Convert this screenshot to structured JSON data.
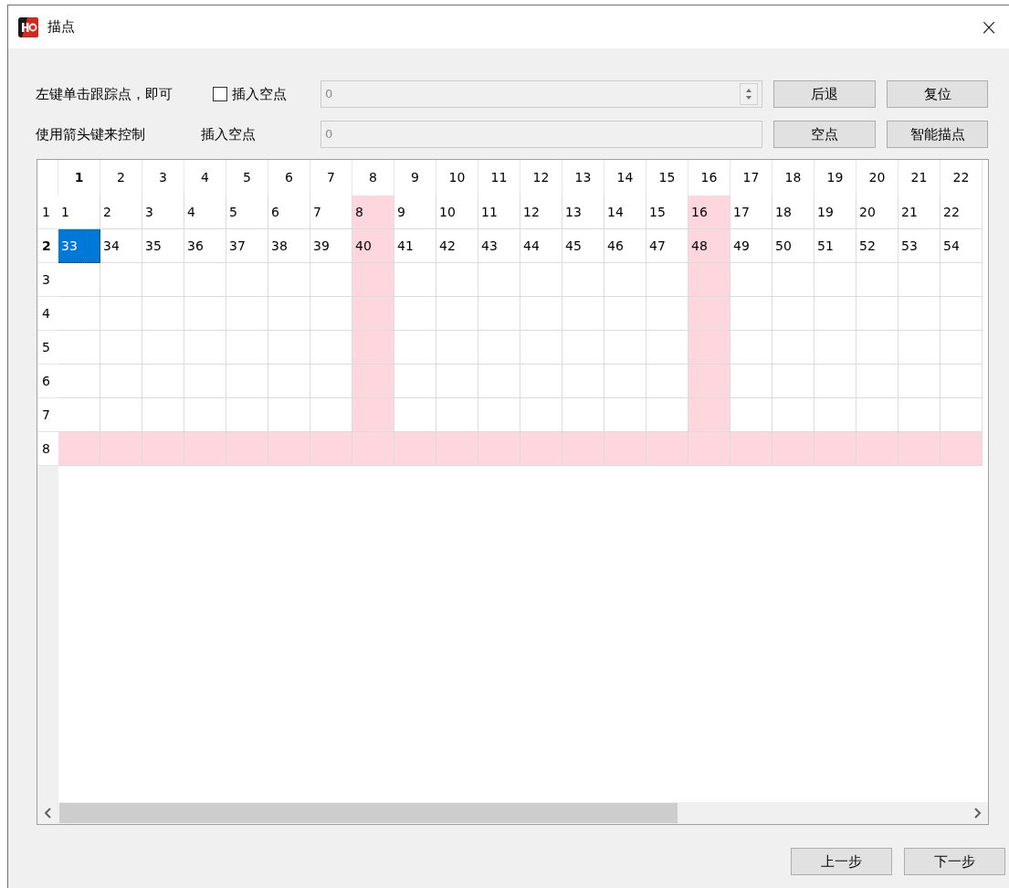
{
  "window": {
    "title": "描点",
    "close": "×"
  },
  "controls": {
    "hint_1": "左键单击跟踪点，即可",
    "hint_2": "使用箭头键来控制",
    "checkbox": {
      "label": "插入空点",
      "checked": false
    },
    "label_2": "插入空点",
    "field_1": {
      "value": "0",
      "disabled": true
    },
    "field_2": {
      "value": "0",
      "disabled": true
    },
    "buttons": [
      "后退",
      "复位",
      "空点",
      "智能描点"
    ]
  },
  "grid": {
    "columns": [
      {
        "label": "1",
        "selected": true,
        "marked": false
      },
      {
        "label": "2",
        "selected": false,
        "marked": false
      },
      {
        "label": "3",
        "selected": false,
        "marked": false
      },
      {
        "label": "4",
        "selected": false,
        "marked": false
      },
      {
        "label": "5",
        "selected": false,
        "marked": false
      },
      {
        "label": "6",
        "selected": false,
        "marked": false
      },
      {
        "label": "7",
        "selected": false,
        "marked": false
      },
      {
        "label": "8",
        "selected": false,
        "marked": true
      },
      {
        "label": "9",
        "selected": false,
        "marked": false
      },
      {
        "label": "10",
        "selected": false,
        "marked": false
      },
      {
        "label": "11",
        "selected": false,
        "marked": false
      },
      {
        "label": "12",
        "selected": false,
        "marked": false
      },
      {
        "label": "13",
        "selected": false,
        "marked": false
      },
      {
        "label": "14",
        "selected": false,
        "marked": false
      },
      {
        "label": "15",
        "selected": false,
        "marked": false
      },
      {
        "label": "16",
        "selected": false,
        "marked": true
      },
      {
        "label": "17",
        "selected": false,
        "marked": false
      },
      {
        "label": "18",
        "selected": false,
        "marked": false
      },
      {
        "label": "19",
        "selected": false,
        "marked": false
      },
      {
        "label": "20",
        "selected": false,
        "marked": false
      },
      {
        "label": "21",
        "selected": false,
        "marked": false
      },
      {
        "label": "22",
        "selected": false,
        "marked": false
      }
    ],
    "rows": [
      {
        "label": "1",
        "selected": false,
        "marked": false,
        "cells": [
          {
            "text": "1",
            "selected": false
          },
          {
            "text": "2",
            "selected": false
          },
          {
            "text": "3",
            "selected": false
          },
          {
            "text": "4",
            "selected": false
          },
          {
            "text": "5",
            "selected": false
          },
          {
            "text": "6",
            "selected": false
          },
          {
            "text": "7",
            "selected": false
          },
          {
            "text": "8",
            "selected": false
          },
          {
            "text": "9",
            "selected": false
          },
          {
            "text": "10",
            "selected": false
          },
          {
            "text": "11",
            "selected": false
          },
          {
            "text": "12",
            "selected": false
          },
          {
            "text": "13",
            "selected": false
          },
          {
            "text": "14",
            "selected": false
          },
          {
            "text": "15",
            "selected": false
          },
          {
            "text": "16",
            "selected": false
          },
          {
            "text": "17",
            "selected": false
          },
          {
            "text": "18",
            "selected": false
          },
          {
            "text": "19",
            "selected": false
          },
          {
            "text": "20",
            "selected": false
          },
          {
            "text": "21",
            "selected": false
          },
          {
            "text": "22",
            "selected": false
          }
        ]
      },
      {
        "label": "2",
        "selected": true,
        "marked": false,
        "cells": [
          {
            "text": "33",
            "selected": true
          },
          {
            "text": "34",
            "selected": false
          },
          {
            "text": "35",
            "selected": false
          },
          {
            "text": "36",
            "selected": false
          },
          {
            "text": "37",
            "selected": false
          },
          {
            "text": "38",
            "selected": false
          },
          {
            "text": "39",
            "selected": false
          },
          {
            "text": "40",
            "selected": false
          },
          {
            "text": "41",
            "selected": false
          },
          {
            "text": "42",
            "selected": false
          },
          {
            "text": "43",
            "selected": false
          },
          {
            "text": "44",
            "selected": false
          },
          {
            "text": "45",
            "selected": false
          },
          {
            "text": "46",
            "selected": false
          },
          {
            "text": "47",
            "selected": false
          },
          {
            "text": "48",
            "selected": false
          },
          {
            "text": "49",
            "selected": false
          },
          {
            "text": "50",
            "selected": false
          },
          {
            "text": "51",
            "selected": false
          },
          {
            "text": "52",
            "selected": false
          },
          {
            "text": "53",
            "selected": false
          },
          {
            "text": "54",
            "selected": false
          }
        ]
      },
      {
        "label": "3",
        "selected": false,
        "marked": false
      },
      {
        "label": "4",
        "selected": false,
        "marked": false
      },
      {
        "label": "5",
        "selected": false,
        "marked": false
      },
      {
        "label": "6",
        "selected": false,
        "marked": false
      },
      {
        "label": "7",
        "selected": false,
        "marked": false
      },
      {
        "label": "8",
        "selected": false,
        "marked": true
      }
    ]
  },
  "footer_buttons": [
    "上一步",
    "下一步"
  ]
}
